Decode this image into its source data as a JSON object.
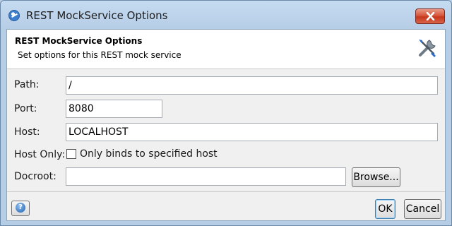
{
  "window": {
    "title": "REST MockService Options",
    "app_icon": "soapui-icon",
    "close_icon": "close-icon"
  },
  "header": {
    "title": "REST MockService Options",
    "subtitle": "Set options for this REST mock service",
    "icon": "tools-icon"
  },
  "form": {
    "path": {
      "label": "Path:",
      "value": "/"
    },
    "port": {
      "label": "Port:",
      "value": "8080"
    },
    "host": {
      "label": "Host:",
      "value": "LOCALHOST"
    },
    "host_only": {
      "label": "Host Only:",
      "checkbox_label": "Only binds to specified host",
      "checked": false
    },
    "docroot": {
      "label": "Docroot:",
      "value": "",
      "browse_label": "Browse..."
    }
  },
  "footer": {
    "help_glyph": "?",
    "ok_label": "OK",
    "cancel_label": "Cancel"
  },
  "colors": {
    "title_bar": "#c5dbf1",
    "close_button": "#c6371c",
    "header_bg": "#ffffff",
    "client_bg": "#f0f0f0"
  }
}
